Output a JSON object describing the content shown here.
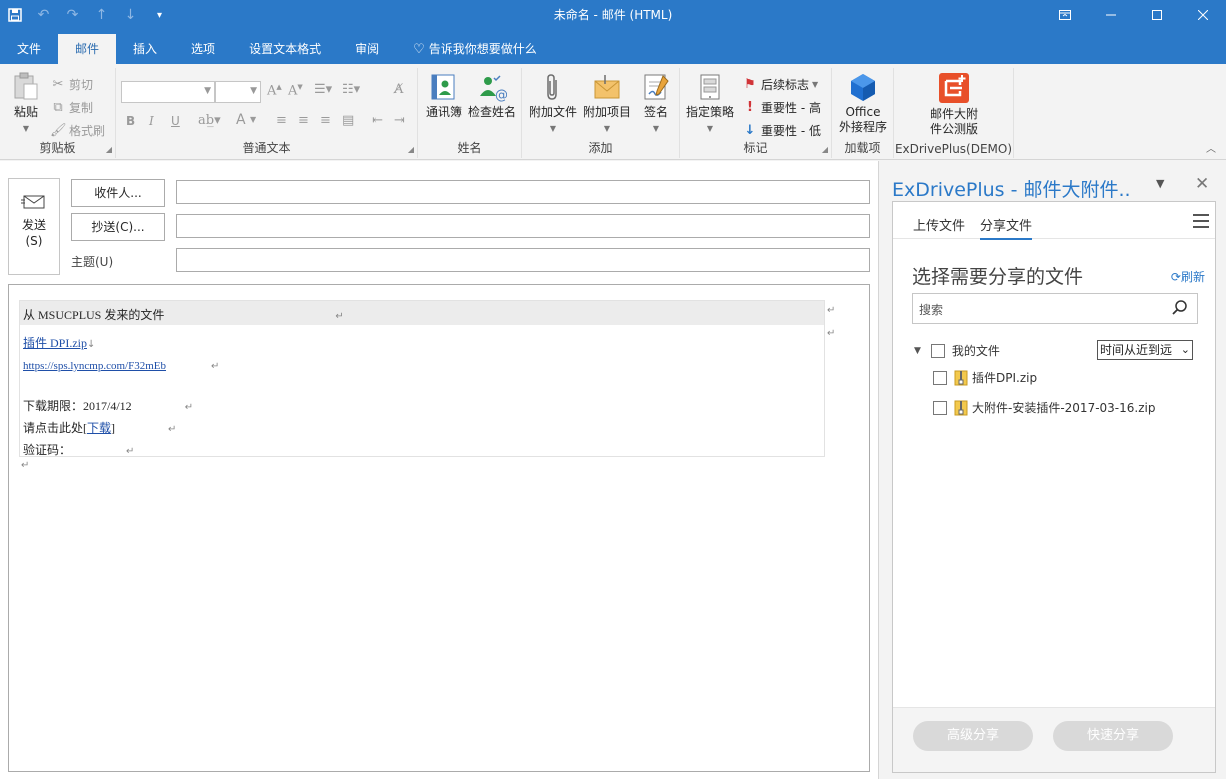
{
  "window": {
    "title": "未命名  -  邮件 (HTML)"
  },
  "qat": {
    "save_icon": "save-icon",
    "undo_icon": "undo-icon",
    "redo_icon": "redo-icon",
    "up_icon": "arrow-up-icon",
    "down_icon": "arrow-down-icon",
    "customize_icon": "customize-qat-icon"
  },
  "tabs": [
    {
      "label": "文件"
    },
    {
      "label": "邮件"
    },
    {
      "label": "插入"
    },
    {
      "label": "选项"
    },
    {
      "label": "设置文本格式"
    },
    {
      "label": "审阅"
    },
    {
      "label": "告诉我你想要做什么"
    }
  ],
  "ribbon": {
    "clipboard": {
      "label": "剪贴板",
      "paste": "粘贴",
      "cut": "剪切",
      "copy": "复制",
      "format_painter": "格式刷"
    },
    "basic_text": {
      "label": "普通文本",
      "bold": "B",
      "italic": "I",
      "underline": "U",
      "font_color": "A"
    },
    "names": {
      "label": "姓名",
      "address_book": "通讯簿",
      "check_names": "检查姓名"
    },
    "include": {
      "label": "添加",
      "attach_file": "附加文件",
      "attach_item": "附加项目",
      "signature": "签名"
    },
    "tags": {
      "label": "标记",
      "policy": "指定策略",
      "follow_up": "后续标志",
      "high": "重要性 - 高",
      "low": "重要性 - 低"
    },
    "addins": {
      "label": "加载项",
      "office_line1": "Office",
      "office_line2": "外接程序"
    },
    "exdrive": {
      "label": "ExDrivePlus(DEMO)",
      "btn_line1": "邮件大附",
      "btn_line2": "件公测版"
    }
  },
  "compose": {
    "send_line1": "发送",
    "send_line2": "(S)",
    "to_button": "收件人...",
    "cc_button": "抄送(C)...",
    "subject_label": "主题(U)",
    "to_value": "",
    "cc_value": "",
    "subject_value": ""
  },
  "message": {
    "header": "从 MSUCPLUS 发来的文件",
    "file_link": "插件 DPI.zip",
    "url": "https://sps.lyncmp.com/F32mEb",
    "expiry_label": "下载期限：",
    "expiry_date": "2017/4/12",
    "click_prefix": "请点击此处[",
    "download_link": "下载",
    "click_suffix": "]",
    "code_label": "验证码：",
    "para_mark": "↵",
    "line_mark": "↓"
  },
  "pane": {
    "title": "ExDrivePlus - 邮件大附件..",
    "tab_upload": "上传文件",
    "tab_share": "分享文件",
    "section_title": "选择需要分享的文件",
    "refresh": "刷新",
    "search_placeholder": "搜索",
    "root_folder": "我的文件",
    "sort_value": "时间从近到远",
    "files": [
      {
        "name": "插件DPI.zip"
      },
      {
        "name": "大附件-安装插件-2017-03-16.zip"
      }
    ],
    "advanced_share": "高级分享",
    "quick_share": "快速分享"
  },
  "colors": {
    "brand": "#2b79c8",
    "link": "#1f4fa8",
    "disabled_button": "#d9d9d9",
    "exdrive_red": "#e8502a"
  }
}
